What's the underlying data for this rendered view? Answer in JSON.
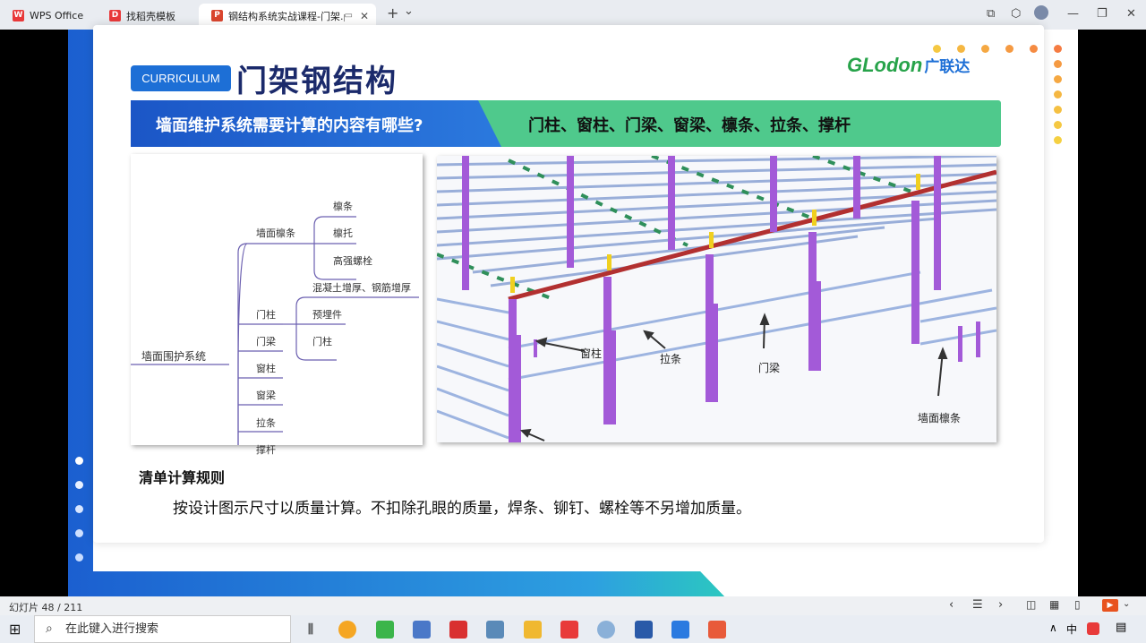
{
  "titlebar": {
    "tabs": [
      {
        "label": "WPS Office",
        "icon": "wps-icon"
      },
      {
        "label": "找稻壳模板",
        "icon": "docer-icon"
      },
      {
        "label": "钢结构系统实战课程-门架.ppt",
        "icon": "ppt-icon"
      }
    ],
    "new_tab": "+",
    "tab_menu": "⌄"
  },
  "slide": {
    "badge": "CURRICULUM",
    "title": "门架钢结构",
    "logo_text": "GLodon",
    "logo_cn": "广联达",
    "banner_question": "墙面维护系统需要计算的内容有哪些?",
    "banner_answer": "门柱、窗柱、门梁、窗梁、檩条、拉条、撑杆",
    "mindmap": {
      "root": "墙面围护系统",
      "branch1": "墙面檩条",
      "b1_children": [
        "檩条",
        "檩托",
        "高强螺栓"
      ],
      "branch2": "门柱",
      "b2_children": [
        "混凝土增厚、钢筋增厚",
        "预埋件",
        "门柱"
      ],
      "branch3": "门梁",
      "branch4": "窗柱",
      "branch5": "窗梁",
      "branch6": "拉条",
      "branch7": "撑杆"
    },
    "model_labels": {
      "window_column": "窗柱",
      "tie_bar": "拉条",
      "door_beam": "门梁",
      "wall_purlin": "墙面檩条"
    },
    "rule_heading": "清单计算规则",
    "rule_text": "按设计图示尺寸以质量计算。不扣除孔眼的质量，焊条、铆钉、螺栓等不另增加质量。"
  },
  "statusbar": {
    "slide_counter": "幻灯片 48 / 211"
  },
  "taskbar": {
    "search_placeholder": "在此键入进行搜索",
    "ime": "中"
  },
  "colors": {
    "accent_blue": "#1d6fd6",
    "accent_green": "#27a34a",
    "banner_blue": "#1f5fc4",
    "banner_green": "#4fc98c",
    "column_purple": "#a35ad8",
    "dot_orange": "#f5a623"
  }
}
